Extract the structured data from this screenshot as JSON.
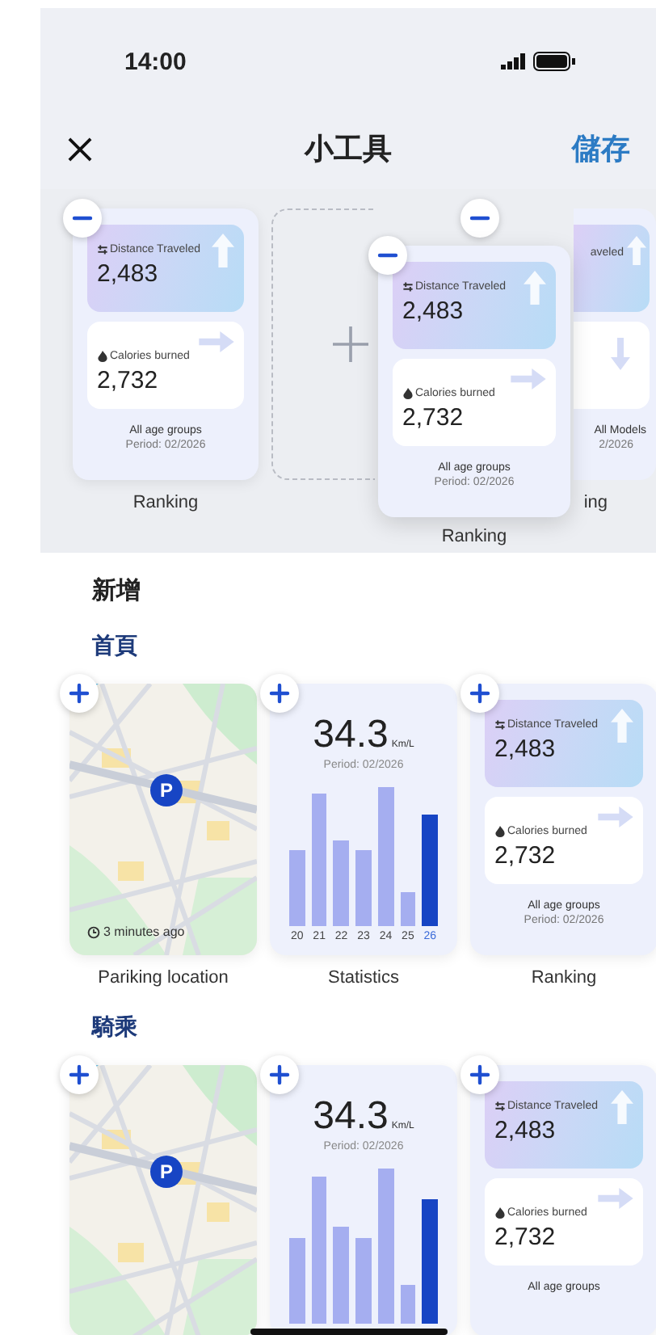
{
  "status_bar": {
    "time": "14:00"
  },
  "nav": {
    "title": "小工具",
    "save": "儲存"
  },
  "edit_slots": [
    {
      "kind": "ranking",
      "distance_label": "Distance Traveled",
      "distance_value": "2,483",
      "calories_label": "Calories burned",
      "calories_value": "2,732",
      "group": "All age groups",
      "period": "Period: 02/2026",
      "label": "Ranking"
    },
    {
      "kind": "empty"
    },
    {
      "kind": "ranking_covered",
      "distance_label": "aveled",
      "group": "All Models",
      "period": "2/2026",
      "label": "ing"
    }
  ],
  "dragged_widget": {
    "kind": "ranking",
    "distance_label": "Distance Traveled",
    "distance_value": "2,483",
    "calories_label": "Calories burned",
    "calories_value": "2,732",
    "group": "All age groups",
    "period": "Period: 02/2026",
    "label": "Ranking"
  },
  "add_title": "新增",
  "sections": [
    {
      "title": "首頁",
      "widgets": [
        {
          "kind": "map",
          "pin": "P",
          "time": "3 minutes ago",
          "label": "Pariking location"
        },
        {
          "kind": "stats",
          "value": "34.3",
          "unit": "Km/L",
          "period": "Period: 02/2026",
          "bars": [
            {
              "label": "20",
              "selected": false
            },
            {
              "label": "21",
              "selected": false
            },
            {
              "label": "22",
              "selected": false
            },
            {
              "label": "23",
              "selected": false
            },
            {
              "label": "24",
              "selected": false
            },
            {
              "label": "25",
              "selected": false
            },
            {
              "label": "26",
              "selected": true
            }
          ],
          "label": "Statistics"
        },
        {
          "kind": "ranking",
          "distance_label": "Distance Traveled",
          "distance_value": "2,483",
          "calories_label": "Calories burned",
          "calories_value": "2,732",
          "group": "All age groups",
          "period": "Period: 02/2026",
          "label": "Ranking"
        }
      ]
    },
    {
      "title": "騎乘",
      "widgets": [
        {
          "kind": "map",
          "pin": "P"
        },
        {
          "kind": "stats",
          "value": "34.3",
          "unit": "Km/L",
          "period": "Period: 02/2026",
          "bars": [
            {
              "selected": false
            },
            {
              "selected": false
            },
            {
              "selected": false
            },
            {
              "selected": false
            },
            {
              "selected": false
            },
            {
              "selected": false
            },
            {
              "selected": true
            }
          ]
        },
        {
          "kind": "ranking",
          "distance_label": "Distance Traveled",
          "distance_value": "2,483",
          "calories_label": "Calories burned",
          "calories_value": "2,732",
          "group": "All age groups"
        }
      ]
    }
  ]
}
